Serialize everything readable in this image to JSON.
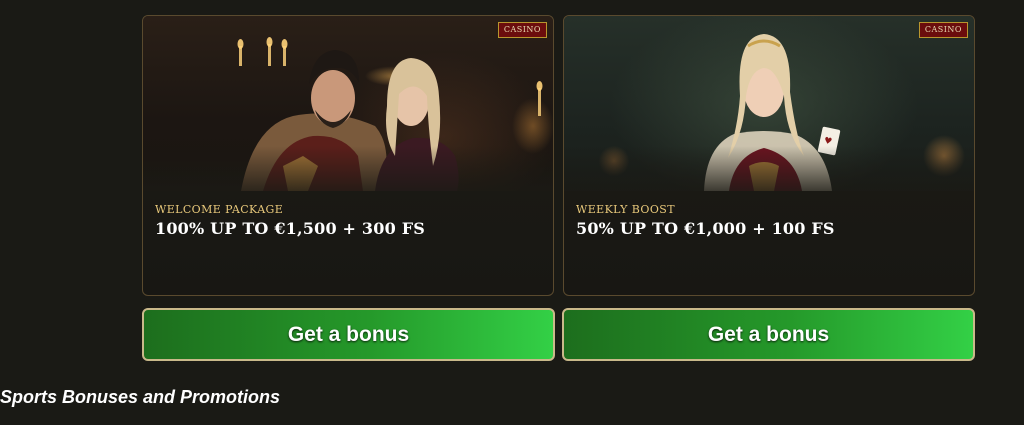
{
  "promotions": [
    {
      "badge": "CASINO",
      "subtitle": "WELCOME PACKAGE",
      "headline": "100% UP TO €1,500 + 300 FS",
      "button_label": "Get a bonus",
      "image": "royal-couple-illustration"
    },
    {
      "badge": "CASINO",
      "subtitle": "WEEKLY BOOST",
      "headline": "50% UP TO €1,000 + 100 FS",
      "button_label": "Get a bonus",
      "image": "queen-with-card-illustration"
    }
  ],
  "section": {
    "heading": "Sports Bonuses and Promotions"
  },
  "colors": {
    "background": "#1a1a15",
    "accent_gold": "#e7c77a",
    "badge_red": "#6b0d0d",
    "button_green": "#25992a"
  }
}
